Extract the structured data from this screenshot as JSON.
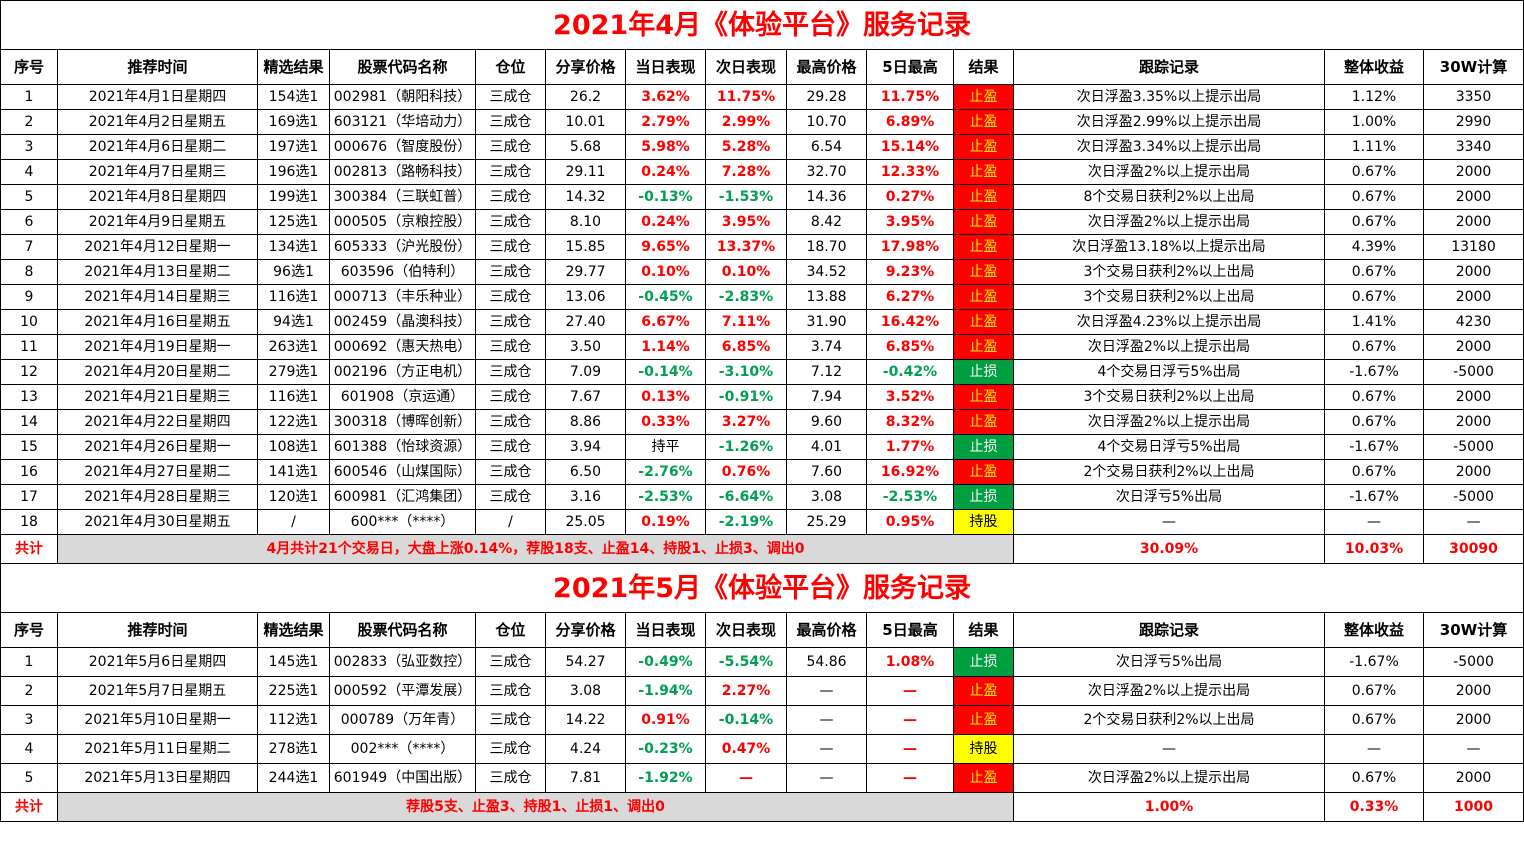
{
  "columns": [
    "序号",
    "推荐时间",
    "精选结果",
    "股票代码名称",
    "仓位",
    "分享价格",
    "当日表现",
    "次日表现",
    "最高价格",
    "5日最高",
    "结果",
    "跟踪记录",
    "整体收益",
    "30W计算"
  ],
  "april": {
    "title": "2021年4月《体验平台》服务记录",
    "rows": [
      {
        "no": "1",
        "date": "2021年4月1日星期四",
        "pick": "154选1",
        "stock": "002981（朝阳科技）",
        "pos": "三成仓",
        "price": "26.2",
        "day": "3.62%",
        "day_c": "red",
        "next": "11.75%",
        "next_c": "red",
        "high": "29.28",
        "high5": "11.75%",
        "high5_c": "red",
        "res": "止盈",
        "res_c": "red",
        "track": "次日浮盈3.35%以上提示出局",
        "gain": "1.12%",
        "w30": "3350"
      },
      {
        "no": "2",
        "date": "2021年4月2日星期五",
        "pick": "169选1",
        "stock": "603121（华培动力）",
        "pos": "三成仓",
        "price": "10.01",
        "day": "2.79%",
        "day_c": "red",
        "next": "2.99%",
        "next_c": "red",
        "high": "10.70",
        "high5": "6.89%",
        "high5_c": "red",
        "res": "止盈",
        "res_c": "red",
        "track": "次日浮盈2.99%以上提示出局",
        "gain": "1.00%",
        "w30": "2990"
      },
      {
        "no": "3",
        "date": "2021年4月6日星期二",
        "pick": "197选1",
        "stock": "000676（智度股份）",
        "pos": "三成仓",
        "price": "5.68",
        "day": "5.98%",
        "day_c": "red",
        "next": "5.28%",
        "next_c": "red",
        "high": "6.54",
        "high5": "15.14%",
        "high5_c": "red",
        "res": "止盈",
        "res_c": "red",
        "track": "次日浮盈3.34%以上提示出局",
        "gain": "1.11%",
        "w30": "3340"
      },
      {
        "no": "4",
        "date": "2021年4月7日星期三",
        "pick": "196选1",
        "stock": "002813（路畅科技）",
        "pos": "三成仓",
        "price": "29.11",
        "day": "0.24%",
        "day_c": "red",
        "next": "7.28%",
        "next_c": "red",
        "high": "32.70",
        "high5": "12.33%",
        "high5_c": "red",
        "res": "止盈",
        "res_c": "red",
        "track": "次日浮盈2%以上提示出局",
        "gain": "0.67%",
        "w30": "2000"
      },
      {
        "no": "5",
        "date": "2021年4月8日星期四",
        "pick": "199选1",
        "stock": "300384（三联虹普）",
        "pos": "三成仓",
        "price": "14.32",
        "day": "-0.13%",
        "day_c": "green",
        "next": "-1.53%",
        "next_c": "green",
        "high": "14.36",
        "high5": "0.27%",
        "high5_c": "red",
        "res": "止盈",
        "res_c": "red",
        "track": "8个交易日获利2%以上出局",
        "gain": "0.67%",
        "w30": "2000"
      },
      {
        "no": "6",
        "date": "2021年4月9日星期五",
        "pick": "125选1",
        "stock": "000505（京粮控股）",
        "pos": "三成仓",
        "price": "8.10",
        "day": "0.24%",
        "day_c": "red",
        "next": "3.95%",
        "next_c": "red",
        "high": "8.42",
        "high5": "3.95%",
        "high5_c": "red",
        "res": "止盈",
        "res_c": "red",
        "track": "次日浮盈2%以上提示出局",
        "gain": "0.67%",
        "w30": "2000"
      },
      {
        "no": "7",
        "date": "2021年4月12日星期一",
        "pick": "134选1",
        "stock": "605333（沪光股份）",
        "pos": "三成仓",
        "price": "15.85",
        "day": "9.65%",
        "day_c": "red",
        "next": "13.37%",
        "next_c": "red",
        "high": "18.70",
        "high5": "17.98%",
        "high5_c": "red",
        "res": "止盈",
        "res_c": "red",
        "track": "次日浮盈13.18%以上提示出局",
        "gain": "4.39%",
        "w30": "13180"
      },
      {
        "no": "8",
        "date": "2021年4月13日星期二",
        "pick": "96选1",
        "stock": "603596（伯特利）",
        "pos": "三成仓",
        "price": "29.77",
        "day": "0.10%",
        "day_c": "red",
        "next": "0.10%",
        "next_c": "red",
        "high": "34.52",
        "high5": "9.23%",
        "high5_c": "red",
        "res": "止盈",
        "res_c": "red",
        "track": "3个交易日获利2%以上出局",
        "gain": "0.67%",
        "w30": "2000"
      },
      {
        "no": "9",
        "date": "2021年4月14日星期三",
        "pick": "116选1",
        "stock": "000713（丰乐种业）",
        "pos": "三成仓",
        "price": "13.06",
        "day": "-0.45%",
        "day_c": "green",
        "next": "-2.83%",
        "next_c": "green",
        "high": "13.88",
        "high5": "6.27%",
        "high5_c": "red",
        "res": "止盈",
        "res_c": "red",
        "track": "3个交易日获利2%以上出局",
        "gain": "0.67%",
        "w30": "2000"
      },
      {
        "no": "10",
        "date": "2021年4月16日星期五",
        "pick": "94选1",
        "stock": "002459（晶澳科技）",
        "pos": "三成仓",
        "price": "27.40",
        "day": "6.67%",
        "day_c": "red",
        "next": "7.11%",
        "next_c": "red",
        "high": "31.90",
        "high5": "16.42%",
        "high5_c": "red",
        "res": "止盈",
        "res_c": "red",
        "track": "次日浮盈4.23%以上提示出局",
        "gain": "1.41%",
        "w30": "4230"
      },
      {
        "no": "11",
        "date": "2021年4月19日星期一",
        "pick": "263选1",
        "stock": "000692（惠天热电）",
        "pos": "三成仓",
        "price": "3.50",
        "day": "1.14%",
        "day_c": "red",
        "next": "6.85%",
        "next_c": "red",
        "high": "3.74",
        "high5": "6.85%",
        "high5_c": "red",
        "res": "止盈",
        "res_c": "red",
        "track": "次日浮盈2%以上提示出局",
        "gain": "0.67%",
        "w30": "2000"
      },
      {
        "no": "12",
        "date": "2021年4月20日星期二",
        "pick": "279选1",
        "stock": "002196（方正电机）",
        "pos": "三成仓",
        "price": "7.09",
        "day": "-0.14%",
        "day_c": "green",
        "next": "-3.10%",
        "next_c": "green",
        "high": "7.12",
        "high5": "-0.42%",
        "high5_c": "green",
        "res": "止损",
        "res_c": "green",
        "track": "4个交易日浮亏5%出局",
        "gain": "-1.67%",
        "w30": "-5000"
      },
      {
        "no": "13",
        "date": "2021年4月21日星期三",
        "pick": "116选1",
        "stock": "601908（京运通）",
        "pos": "三成仓",
        "price": "7.67",
        "day": "0.13%",
        "day_c": "red",
        "next": "-0.91%",
        "next_c": "green",
        "high": "7.94",
        "high5": "3.52%",
        "high5_c": "red",
        "res": "止盈",
        "res_c": "red",
        "track": "3个交易日获利2%以上出局",
        "gain": "0.67%",
        "w30": "2000"
      },
      {
        "no": "14",
        "date": "2021年4月22日星期四",
        "pick": "122选1",
        "stock": "300318（博晖创新）",
        "pos": "三成仓",
        "price": "8.86",
        "day": "0.33%",
        "day_c": "red",
        "next": "3.27%",
        "next_c": "red",
        "high": "9.60",
        "high5": "8.32%",
        "high5_c": "red",
        "res": "止盈",
        "res_c": "red",
        "track": "次日浮盈2%以上提示出局",
        "gain": "0.67%",
        "w30": "2000"
      },
      {
        "no": "15",
        "date": "2021年4月26日星期一",
        "pick": "108选1",
        "stock": "601388（怡球资源）",
        "pos": "三成仓",
        "price": "3.94",
        "day": "持平",
        "day_c": "plain",
        "next": "-1.26%",
        "next_c": "green",
        "high": "4.01",
        "high5": "1.77%",
        "high5_c": "red",
        "res": "止损",
        "res_c": "green",
        "track": "4个交易日浮亏5%出局",
        "gain": "-1.67%",
        "w30": "-5000"
      },
      {
        "no": "16",
        "date": "2021年4月27日星期二",
        "pick": "141选1",
        "stock": "600546（山煤国际）",
        "pos": "三成仓",
        "price": "6.50",
        "day": "-2.76%",
        "day_c": "green",
        "next": "0.76%",
        "next_c": "red",
        "high": "7.60",
        "high5": "16.92%",
        "high5_c": "red",
        "res": "止盈",
        "res_c": "red",
        "track": "2个交易日获利2%以上出局",
        "gain": "0.67%",
        "w30": "2000"
      },
      {
        "no": "17",
        "date": "2021年4月28日星期三",
        "pick": "120选1",
        "stock": "600981（汇鸿集团）",
        "pos": "三成仓",
        "price": "3.16",
        "day": "-2.53%",
        "day_c": "green",
        "next": "-6.64%",
        "next_c": "green",
        "high": "3.08",
        "high5": "-2.53%",
        "high5_c": "green",
        "res": "止损",
        "res_c": "green",
        "track": "次日浮亏5%出局",
        "gain": "-1.67%",
        "w30": "-5000"
      },
      {
        "no": "18",
        "date": "2021年4月30日星期五",
        "pick": "/",
        "stock": "600***（****）",
        "pos": "/",
        "price": "25.05",
        "day": "0.19%",
        "day_c": "red",
        "next": "-2.19%",
        "next_c": "green",
        "high": "25.29",
        "high5": "0.95%",
        "high5_c": "red",
        "res": "持股",
        "res_c": "yellow",
        "track": "—",
        "gain": "—",
        "w30": "—"
      }
    ],
    "total": {
      "label": "共计",
      "summary": "4月共计21个交易日，大盘上涨0.14%，荐股18支、止盈14、持股1、止损3、调出0",
      "track": "30.09%",
      "gain": "10.03%",
      "w30": "30090"
    }
  },
  "may": {
    "title": "2021年5月《体验平台》服务记录",
    "rows": [
      {
        "no": "1",
        "date": "2021年5月6日星期四",
        "pick": "145选1",
        "stock": "002833（弘亚数控）",
        "pos": "三成仓",
        "price": "54.27",
        "day": "-0.49%",
        "day_c": "green",
        "next": "-5.54%",
        "next_c": "green",
        "high": "54.86",
        "high5": "1.08%",
        "high5_c": "red",
        "res": "止损",
        "res_c": "green",
        "track": "次日浮亏5%出局",
        "gain": "-1.67%",
        "w30": "-5000"
      },
      {
        "no": "2",
        "date": "2021年5月7日星期五",
        "pick": "225选1",
        "stock": "000592（平潭发展）",
        "pos": "三成仓",
        "price": "3.08",
        "day": "-1.94%",
        "day_c": "green",
        "next": "2.27%",
        "next_c": "red",
        "high": "—",
        "high5": "—",
        "high5_c": "red",
        "res": "止盈",
        "res_c": "red",
        "track": "次日浮盈2%以上提示出局",
        "gain": "0.67%",
        "w30": "2000"
      },
      {
        "no": "3",
        "date": "2021年5月10日星期一",
        "pick": "112选1",
        "stock": "000789（万年青）",
        "pos": "三成仓",
        "price": "14.22",
        "day": "0.91%",
        "day_c": "red",
        "next": "-0.14%",
        "next_c": "green",
        "high": "—",
        "high5": "—",
        "high5_c": "red",
        "res": "止盈",
        "res_c": "red",
        "track": "2个交易日获利2%以上出局",
        "gain": "0.67%",
        "w30": "2000"
      },
      {
        "no": "4",
        "date": "2021年5月11日星期二",
        "pick": "278选1",
        "stock": "002***（****）",
        "pos": "三成仓",
        "price": "4.24",
        "day": "-0.23%",
        "day_c": "green",
        "next": "0.47%",
        "next_c": "red",
        "high": "—",
        "high5": "—",
        "high5_c": "red",
        "res": "持股",
        "res_c": "yellow",
        "track": "—",
        "gain": "—",
        "w30": "—"
      },
      {
        "no": "5",
        "date": "2021年5月13日星期四",
        "pick": "244选1",
        "stock": "601949（中国出版）",
        "pos": "三成仓",
        "price": "7.81",
        "day": "-1.92%",
        "day_c": "green",
        "next": "—",
        "next_c": "red",
        "high": "—",
        "high5": "—",
        "high5_c": "red",
        "res": "止盈",
        "res_c": "red",
        "track": "次日浮盈2%以上提示出局",
        "gain": "0.67%",
        "w30": "2000"
      }
    ],
    "total": {
      "label": "共计",
      "summary": "荐股5支、止盈3、持股1、止损1、调出0",
      "track": "1.00%",
      "gain": "0.33%",
      "w30": "1000"
    }
  }
}
